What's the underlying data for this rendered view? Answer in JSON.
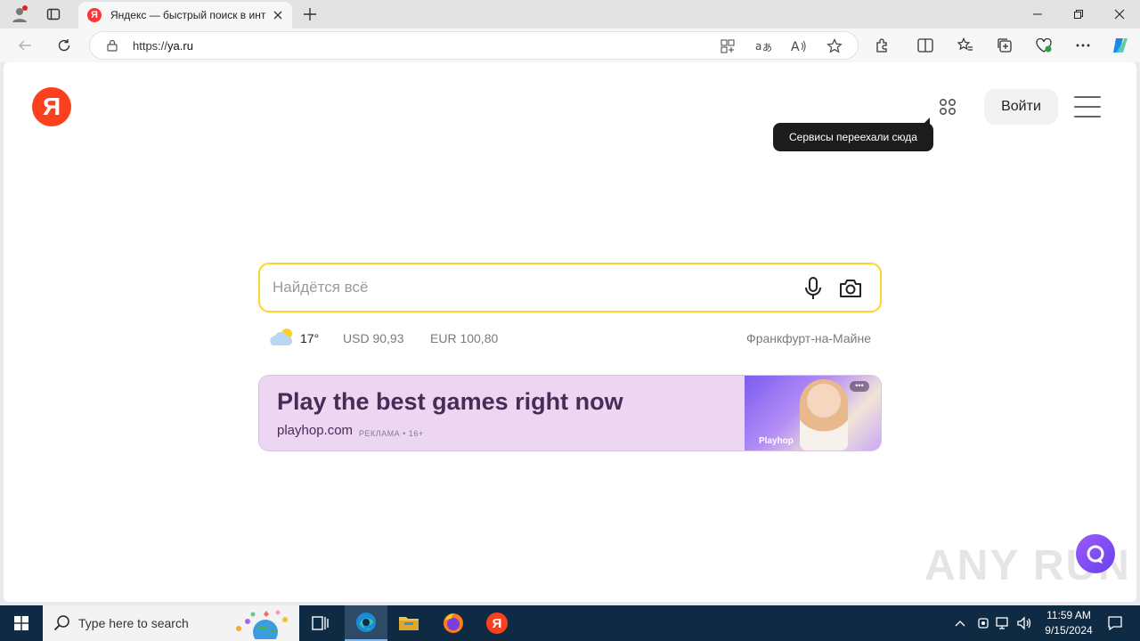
{
  "browser": {
    "tab": {
      "title": "Яндекс — быстрый поиск в инт",
      "favicon_letter": "Я"
    },
    "address_bar": {
      "url_scheme": "https://",
      "url_host": "ya.ru"
    }
  },
  "page": {
    "logo_letter": "Я",
    "header": {
      "login_label": "Войти",
      "tooltip": "Сервисы переехали сюда"
    },
    "search": {
      "placeholder": "Найдётся всё"
    },
    "info": {
      "temperature": "17°",
      "usd": "USD 90,93",
      "eur": "EUR 100,80",
      "city": "Франкфурт-на-Майне"
    },
    "ad": {
      "headline": "Play the best games right now",
      "domain": "playhop.com",
      "label": "РЕКЛАМА • 16+",
      "brand": "Playhop",
      "more": "•••"
    },
    "watermark": "ANY RUN"
  },
  "taskbar": {
    "search_placeholder": "Type here to search",
    "apps": [
      "task-view",
      "edge",
      "file-explorer",
      "firefox",
      "yandex-browser"
    ],
    "yandex_letter": "Я",
    "clock": {
      "time": "11:59 AM",
      "date": "9/15/2024"
    }
  },
  "colors": {
    "yandex_red": "#fc3f1d",
    "search_border": "#fed42b",
    "ad_background": "#ecd6f2",
    "ad_text": "#4a2a56",
    "taskbar": "#0f2a43",
    "alice": "#7b4cf3"
  }
}
